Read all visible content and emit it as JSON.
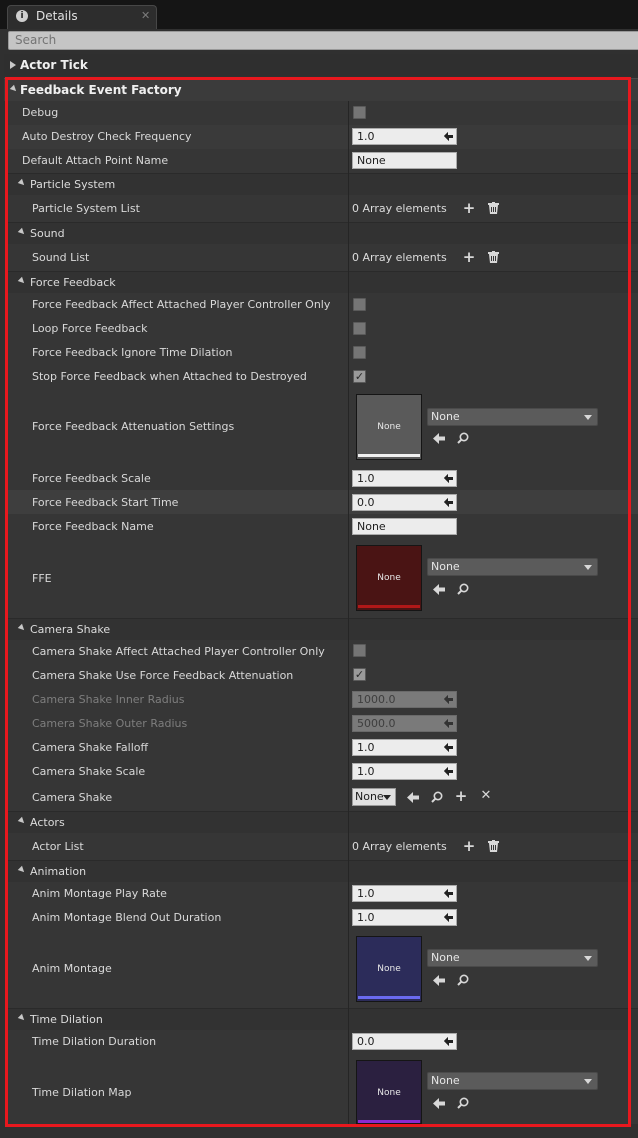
{
  "tab": {
    "title": "Details",
    "icon": "info-icon",
    "close": "✕"
  },
  "search": {
    "placeholder": "Search"
  },
  "categories": {
    "actor_tick": "Actor Tick",
    "feedback_event_factory": "Feedback Event Factory"
  },
  "props": {
    "debug": "Debug",
    "auto_destroy": "Auto Destroy Check Frequency",
    "auto_destroy_value": "1.0",
    "default_attach": "Default Attach Point Name",
    "default_attach_value": "None"
  },
  "particle": {
    "header": "Particle System",
    "list": "Particle System List",
    "value": "0 Array elements"
  },
  "sound": {
    "header": "Sound",
    "list": "Sound List",
    "value": "0 Array elements"
  },
  "force": {
    "header": "Force Feedback",
    "affect": "Force Feedback Affect Attached Player Controller Only",
    "loop": "Loop Force Feedback",
    "ignore": "Force Feedback Ignore Time Dilation",
    "stop": "Stop Force Feedback when Attached to Destroyed",
    "attenuation": "Force Feedback Attenuation Settings",
    "attenuation_thumb": "None",
    "attenuation_combo": "None",
    "scale": "Force Feedback Scale",
    "scale_value": "1.0",
    "start": "Force Feedback Start Time",
    "start_value": "0.0",
    "name": "Force Feedback Name",
    "name_value": "None",
    "ffe": "FFE",
    "ffe_thumb": "None",
    "ffe_combo": "None"
  },
  "camera": {
    "header": "Camera Shake",
    "affect": "Camera Shake Affect Attached Player Controller Only",
    "use_att": "Camera Shake Use Force Feedback Attenuation",
    "inner": "Camera Shake Inner Radius",
    "inner_value": "1000.0",
    "outer": "Camera Shake Outer Radius",
    "outer_value": "5000.0",
    "falloff": "Camera Shake Falloff",
    "falloff_value": "1.0",
    "scale": "Camera Shake Scale",
    "scale_value": "1.0",
    "shake": "Camera Shake",
    "shake_value": "None"
  },
  "actors": {
    "header": "Actors",
    "list": "Actor List",
    "value": "0 Array elements"
  },
  "animation": {
    "header": "Animation",
    "rate": "Anim Montage Play Rate",
    "rate_value": "1.0",
    "blend": "Anim Montage Blend Out Duration",
    "blend_value": "1.0",
    "montage": "Anim Montage",
    "montage_thumb": "None",
    "montage_combo": "None"
  },
  "time": {
    "header": "Time Dilation",
    "duration": "Time Dilation Duration",
    "duration_value": "0.0",
    "map": "Time Dilation Map",
    "map_thumb": "None",
    "map_combo": "None"
  },
  "checkbox_states": {
    "debug": false,
    "ff_affect": false,
    "ff_loop": false,
    "ff_ignore": false,
    "ff_stop": true,
    "cs_affect": false,
    "cs_use_att": true
  },
  "colors": {
    "highlight": "#e8181e",
    "ffe_thumb": "#4a1414",
    "ffe_bar": "#b01818",
    "montage_thumb": "#2c2c5a",
    "montage_bar": "#6a6af0",
    "map_thumb": "#2b2040",
    "map_bar": "#8a2ad0"
  }
}
